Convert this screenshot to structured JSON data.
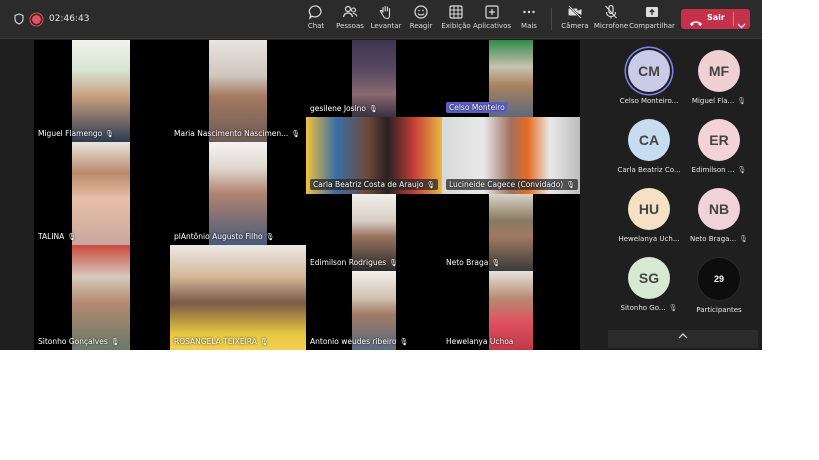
{
  "toolbar": {
    "timer": "02:46:43",
    "buttons": [
      {
        "label": "Chat",
        "icon": "chat-icon"
      },
      {
        "label": "Pessoas",
        "icon": "people-icon"
      },
      {
        "label": "Levantar",
        "icon": "raise-hand-icon"
      },
      {
        "label": "Reagir",
        "icon": "react-icon"
      },
      {
        "label": "Exibição",
        "icon": "view-icon"
      },
      {
        "label": "Aplicativos",
        "icon": "apps-icon"
      },
      {
        "label": "Mais",
        "icon": "more-icon"
      },
      {
        "label": "Câmera",
        "icon": "camera-off-icon"
      },
      {
        "label": "Microfone",
        "icon": "mic-off-icon"
      },
      {
        "label": "Compartilhar",
        "icon": "share-icon"
      }
    ],
    "leave_label": "Sair",
    "colors": {
      "leave": "#c4314b",
      "active_speaker": "#5b5fc7"
    }
  },
  "video_tiles": [
    {
      "name": "Miguel Flamengo"
    },
    {
      "name": "Maria Nascimento Nascimen..."
    },
    {
      "name": "gesilene Josino"
    },
    {
      "name": "Celso Monteiro"
    },
    {
      "name": "Carla Beatriz Costa de Araujo"
    },
    {
      "name": "Lucineide Cagece (Convidado)"
    },
    {
      "name": "TALINA"
    },
    {
      "name": "plAntônio Augusto Filho"
    },
    {
      "name": "Edimilson Rodrigues"
    },
    {
      "name": "Neto Braga"
    },
    {
      "name": "Sitonho Gonçalves"
    },
    {
      "name": "ROSANGELA TEIXEIRA"
    },
    {
      "name": "Antonio weudes ribeiro"
    },
    {
      "name": "Hewelanya Uchoa"
    }
  ],
  "roster": [
    {
      "initials": "CM",
      "name": "Celso Monteiro...",
      "color": "#c9cbe8"
    },
    {
      "initials": "MF",
      "name": "Miguel Fla...",
      "color": "#f1d0d3"
    },
    {
      "initials": "CA",
      "name": "Carla Beatriz Co...",
      "color": "#c7dcf0"
    },
    {
      "initials": "ER",
      "name": "Edimilson ...",
      "color": "#f3d3d6"
    },
    {
      "initials": "HU",
      "name": "Hewelanya Uch...",
      "color": "#f5e1c6"
    },
    {
      "initials": "NB",
      "name": "Neto Braga...",
      "color": "#f0d3d8"
    },
    {
      "initials": "SG",
      "name": "Sitonho Go...",
      "color": "#d7e9d3"
    }
  ],
  "participants": {
    "count": "29",
    "label": "Participantes"
  }
}
